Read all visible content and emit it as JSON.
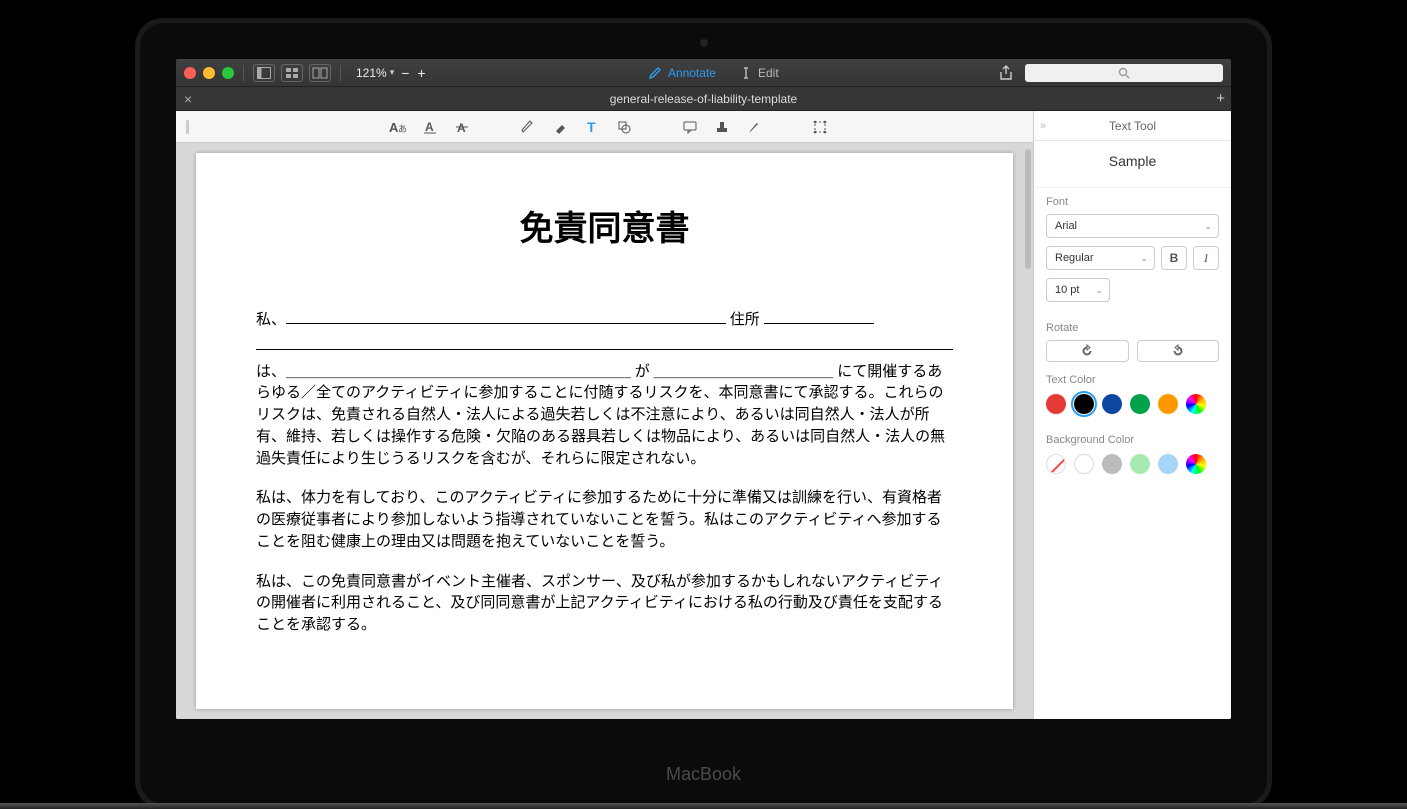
{
  "toolbar": {
    "zoom": "121%",
    "annotate_label": "Annotate",
    "edit_label": "Edit"
  },
  "tab": {
    "title": "general-release-of-liability-template"
  },
  "document": {
    "heading": "免責同意書",
    "line1_prefix": "私、",
    "line1_mid": " 住所 ",
    "line2_mid": " が ",
    "line2_suffix": " にて開催す",
    "para1": "は、＿＿＿＿＿＿＿＿＿＿＿＿＿＿＿＿＿＿＿＿＿＿＿ が ＿＿＿＿＿＿＿＿＿＿＿＿ にて開催するあらゆる／全てのアクティビティに参加することに付随するリスクを、本同意書にて承認する。これらのリスクは、免責される自然人・法人による過失若しくは不注意により、あるいは同自然人・法人が所有、維持、若しくは操作する危険・欠陥のある器具若しくは物品により、あるいは同自然人・法人の無過失責任により生じうるリスクを含むが、それらに限定されない。",
    "para2": "私は、体力を有しており、このアクティビティに参加するために十分に準備又は訓練を行い、有資格者の医療従事者により参加しないよう指導されていないことを誓う。私はこのアクティビティへ参加することを阻む健康上の理由又は問題を抱えていないことを誓う。",
    "para3": "私は、この免責同意書がイベント主催者、スポンサー、及び私が参加するかもしれないアクティビティの開催者に利用されること、及び同同意書が上記アクティビティにおける私の行動及び責任を支配することを承認する。"
  },
  "inspector": {
    "title": "Text Tool",
    "sample": "Sample",
    "font_label": "Font",
    "font_family": "Arial",
    "font_style": "Regular",
    "font_size": "10 pt",
    "bold_label": "B",
    "italic_label": "I",
    "rotate_label": "Rotate",
    "text_color_label": "Text Color",
    "bg_color_label": "Background Color",
    "text_colors": [
      {
        "value": "#e53935"
      },
      {
        "value": "#000000",
        "selected": true
      },
      {
        "value": "#0d47a1"
      },
      {
        "value": "#00a14b"
      },
      {
        "value": "#ff9800"
      }
    ],
    "bg_colors": [
      {
        "class": "none",
        "selected": true
      },
      {
        "class": "white"
      },
      {
        "class": "gray"
      },
      {
        "class": "mint"
      },
      {
        "class": "lightblue"
      }
    ]
  },
  "laptop": {
    "brand": "MacBook"
  }
}
